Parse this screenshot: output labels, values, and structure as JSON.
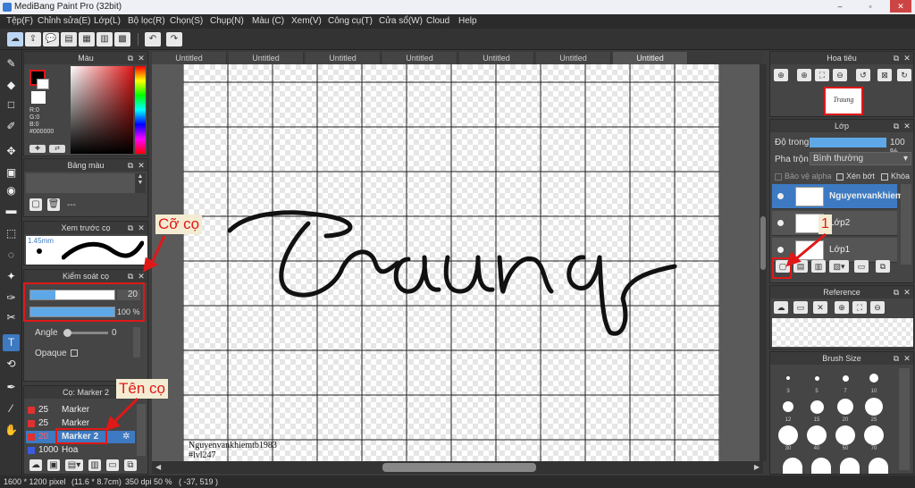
{
  "window": {
    "title": "MediBang Paint Pro (32bit)",
    "controls": [
      "–",
      "▫",
      "✕"
    ]
  },
  "menu": [
    "Tệp(F)",
    "Chỉnh sửa(E)",
    "Lớp(L)",
    "Bộ lọc(R)",
    "Chọn(S)",
    "Chụp(N)",
    "Màu (C)",
    "Xem(V)",
    "Công cụ(T)",
    "Cửa sổ(W)",
    "Cloud",
    "Help"
  ],
  "toolbar": {
    "icons": [
      "cloud-save-icon",
      "share-icon",
      "comment-icon",
      "message-icon",
      "document-icon",
      "layout-icon",
      "grid-icon",
      "undo-icon",
      "redo-icon"
    ],
    "glyphs": [
      "☁",
      "⇪",
      "💬",
      "▤",
      "▦",
      "▥",
      "▩",
      "↶",
      "↷"
    ]
  },
  "tools": {
    "names": [
      "brush-tool-icon",
      "eraser-tool-icon",
      "rectangle-tool-icon",
      "pen-tool-icon",
      "move-tool-icon",
      "fill-tool-icon",
      "bucket-tool-icon",
      "gradient-tool-icon",
      "select-tool-icon",
      "lasso-tool-icon",
      "magic-wand-tool-icon",
      "select-pen-tool-icon",
      "select-eraser-tool-icon",
      "text-tool-icon",
      "operation-tool-icon",
      "eyedropper-tool-icon",
      "dropper-tool-icon",
      "hand-tool-icon"
    ],
    "glyphs": [
      "✎",
      "◆",
      "□",
      "✐",
      "✥",
      "▣",
      "◉",
      "▬",
      "⬚",
      "◌",
      "✦",
      "✑",
      "✂",
      "T",
      "⟲",
      "✒",
      "⁄",
      "✋"
    ]
  },
  "color_panel": {
    "title": "Màu",
    "r": "R:0",
    "g": "G:0",
    "b": "B:0",
    "hex": "#000000",
    "primary": "#000000",
    "secondary": "#ffffff",
    "accent": "#e01818"
  },
  "palette_panel": {
    "title": "Bảng màu",
    "more": "---"
  },
  "preview_panel": {
    "title": "Xem trước cọ",
    "size": "1.45mm"
  },
  "brush_control": {
    "title": "Kiểm soát cọ",
    "size": "20",
    "size_fill": 0.3,
    "opacity": "100 %",
    "opacity_fill": 1.0,
    "angle_label": "Angle",
    "angle_value": "0",
    "opaque_label": "Opaque"
  },
  "brush_list": {
    "title": "Cọ: Marker 2",
    "items": [
      {
        "size": "25",
        "name": "Marker",
        "color": "#e03030"
      },
      {
        "size": "25",
        "name": "Marker",
        "color": "#e03030"
      },
      {
        "size": "20",
        "name": "Marker 2",
        "color": "#e03030"
      },
      {
        "size": "1000",
        "name": "Hoa",
        "color": "#3a5be0"
      }
    ],
    "selected_index": 2
  },
  "annotations": {
    "brush_size": "Cỡ cọ",
    "brush_name": "Tên cọ",
    "step": "1",
    "color": "#e01818"
  },
  "document_tabs": [
    "Untitled",
    "Untitled",
    "Untitled",
    "Untitled",
    "Untitled",
    "Untitled",
    "Untitled"
  ],
  "canvas": {
    "lettering": "Traung",
    "watermark_line1": "Nguyenvankhiemtb1983",
    "watermark_line2": "#lvl247"
  },
  "status": {
    "dimensions": "1600 * 1200 pixel",
    "physical": "(11.6 * 8.7cm)",
    "dpi": "350 dpi",
    "zoom": "50 %",
    "coords": "( -37, 519 )"
  },
  "navigator_panel": {
    "title": "Hoa tiêu",
    "thumb_text": "Traung"
  },
  "layer_panel": {
    "title": "Lớp",
    "opacity_label": "Độ trong",
    "opacity_value": "100 %",
    "blend_label": "Pha trộn",
    "blend_value": "Bình thường",
    "protect_alpha": "Bảo vệ alpha",
    "clip": "Xén bớt",
    "lock": "Khóa",
    "layers": [
      {
        "name": "Nguyenvankhiem",
        "selected": true
      },
      {
        "name": "Lớp2",
        "selected": false
      },
      {
        "name": "Lớp1",
        "selected": false
      }
    ]
  },
  "reference_panel": {
    "title": "Reference"
  },
  "brush_size_panel": {
    "title": "Brush Size",
    "labels": [
      "3",
      "5",
      "7",
      "10",
      "12",
      "15",
      "20",
      "25",
      "30",
      "40",
      "50",
      "70"
    ]
  }
}
